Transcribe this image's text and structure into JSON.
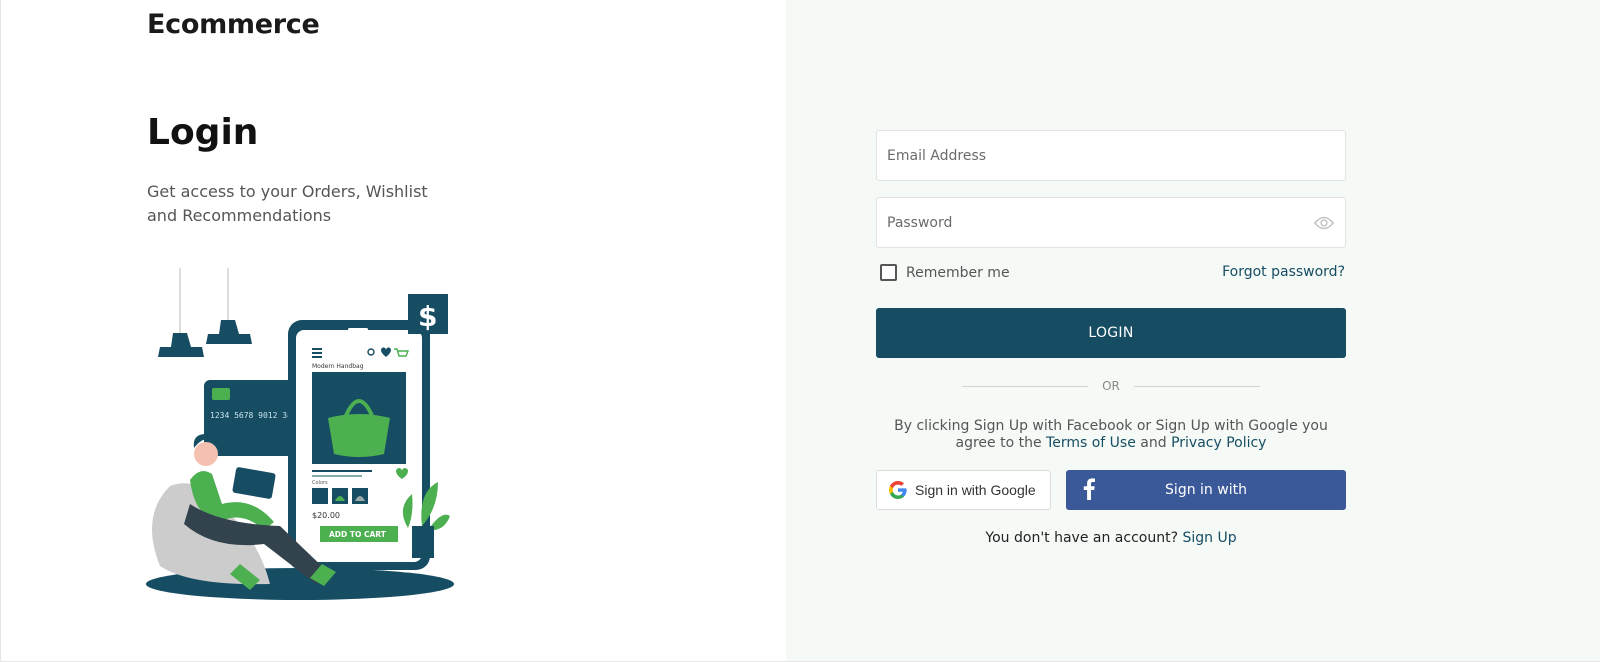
{
  "brand": "Ecommerce",
  "hero": {
    "title": "Login",
    "subtitle": "Get access to your Orders, Wishlist and Recommendations"
  },
  "illustration": {
    "product_title": "Modern Handbag",
    "card_number": "1234 5678 9012 345",
    "price": "$20.00",
    "add_to_cart": "ADD TO CART",
    "dollar_sign": "$",
    "colors_label": "Colors"
  },
  "form": {
    "email_placeholder": "Email Address",
    "password_placeholder": "Password",
    "remember_label": "Remember me",
    "forgot_label": "Forgot password?",
    "login_label": "LOGIN",
    "or_label": "OR",
    "terms_prefix": "By clicking Sign Up with Facebook or Sign Up with Google you agree to the",
    "terms_link": "Terms of Use",
    "terms_and": "and",
    "privacy_link": "Privacy Policy",
    "google_label": "Sign in with Google",
    "facebook_label": "Sign in with",
    "signup_prefix": "You don't have an account?",
    "signup_link": "Sign Up"
  },
  "colors": {
    "primary": "#164d63",
    "facebook": "#3b5998",
    "accent_green": "#4caf50",
    "right_panel_bg": "#f6faf7"
  }
}
